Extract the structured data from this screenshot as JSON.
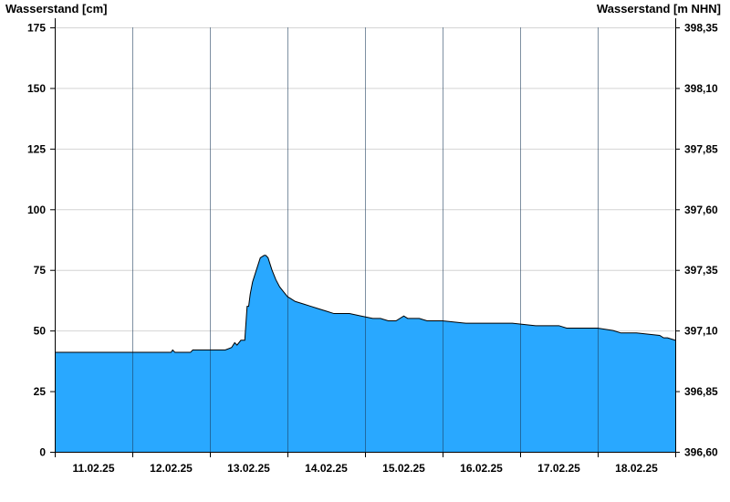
{
  "chart_data": {
    "type": "area",
    "ylabel_left": "Wasserstand [cm]",
    "ylabel_right": "Wasserstand [m NHN]",
    "ylim_left": [
      0,
      175
    ],
    "ylim_right": [
      396.6,
      398.35
    ],
    "yticks_left": [
      "0",
      "25",
      "50",
      "75",
      "100",
      "125",
      "150",
      "175"
    ],
    "yticks_right": [
      "396,60",
      "396,85",
      "397,10",
      "397,35",
      "397,60",
      "397,85",
      "398,10",
      "398,35"
    ],
    "xlim_days": [
      0,
      8
    ],
    "day_labels": [
      "11.02.25",
      "12.02.25",
      "13.02.25",
      "14.02.25",
      "15.02.25",
      "16.02.25",
      "17.02.25",
      "18.02.25"
    ],
    "grid": true,
    "fill_color": "#29a8ff",
    "series": [
      {
        "x": [
          0,
          1.0,
          1.5,
          1.52,
          1.55,
          1.58,
          1.75,
          1.78,
          1.8,
          2.0,
          2.2,
          2.28,
          2.32,
          2.35,
          2.4,
          2.45,
          2.48,
          2.5,
          2.52,
          2.55,
          2.6,
          2.65,
          2.7,
          2.72,
          2.75,
          2.8,
          2.85,
          2.9,
          2.95,
          3.0,
          3.05,
          3.1,
          3.2,
          3.3,
          3.4,
          3.5,
          3.6,
          3.7,
          3.8,
          3.95,
          4.1,
          4.2,
          4.3,
          4.4,
          4.5,
          4.55,
          4.6,
          4.7,
          4.8,
          5.0,
          5.3,
          5.6,
          5.9,
          6.2,
          6.4,
          6.5,
          6.6,
          6.8,
          7.0,
          7.2,
          7.3,
          7.5,
          7.8,
          7.85,
          7.9,
          8.0
        ],
        "y": [
          41,
          41,
          41,
          42,
          41,
          41,
          41,
          42,
          42,
          42,
          42,
          43,
          45,
          44,
          46,
          46,
          60,
          60,
          65,
          70,
          75,
          80,
          81,
          81,
          80,
          75,
          71,
          68,
          66,
          64,
          63,
          62,
          61,
          60,
          59,
          58,
          57,
          57,
          57,
          56,
          55,
          55,
          54,
          54,
          56,
          55,
          55,
          55,
          54,
          54,
          53,
          53,
          53,
          52,
          52,
          52,
          51,
          51,
          51,
          50,
          49,
          49,
          48,
          47,
          47,
          46
        ]
      }
    ]
  }
}
